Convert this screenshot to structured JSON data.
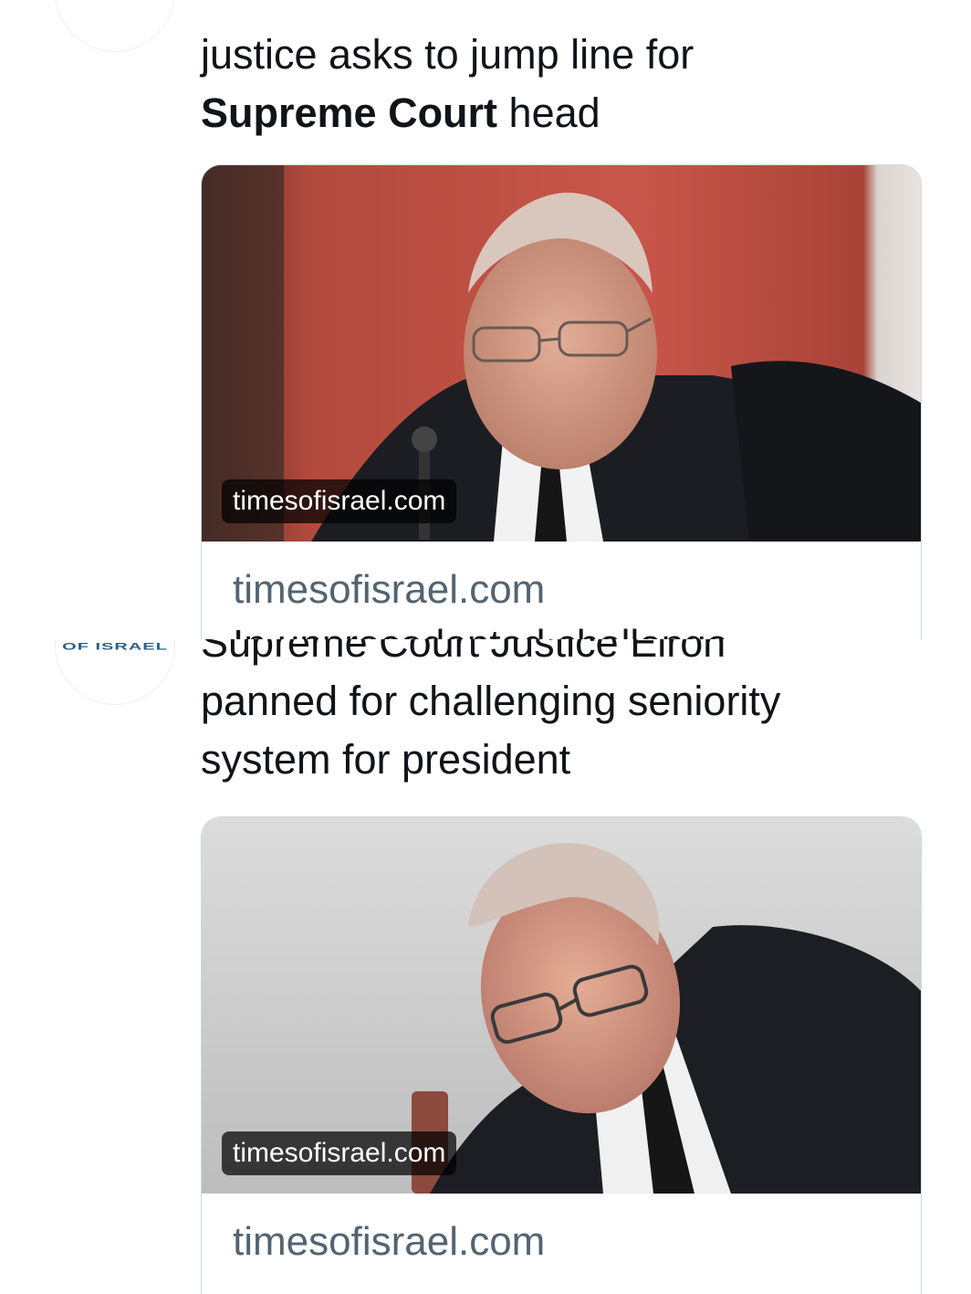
{
  "tweets": [
    {
      "headline_pre": "justice asks to jump line for",
      "headline_bold": "Supreme Court",
      "headline_post": " head",
      "card": {
        "badge": "timesofisrael.com",
        "domain": "timesofisrael.com",
        "desc_cut": "In unprecedented challenge"
      }
    },
    {
      "avatar_text": "OF ISRAEL",
      "headline_cut": "Supreme Court Justice Elron",
      "headline_line1": "panned for challenging seniority",
      "headline_line2": "system for president",
      "card": {
        "badge": "timesofisrael.com",
        "domain": "timesofisrael.com"
      }
    }
  ]
}
